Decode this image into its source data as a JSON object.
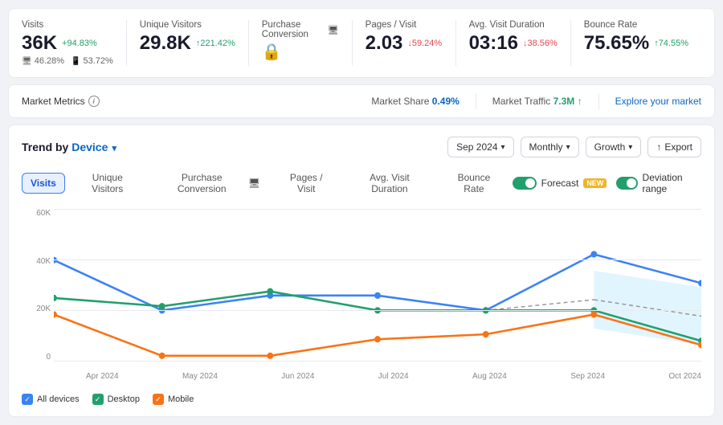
{
  "metrics": [
    {
      "id": "visits",
      "label": "Visits",
      "value": "36K",
      "change": "+94.83%",
      "change_dir": "up",
      "sub": [
        "46.28%",
        "53.72%"
      ],
      "sub_icons": [
        "monitor",
        "mobile"
      ],
      "icon": null
    },
    {
      "id": "unique-visitors",
      "label": "Unique Visitors",
      "value": "29.8K",
      "change": "↑221.42%",
      "change_dir": "up",
      "sub": [],
      "icon": null
    },
    {
      "id": "purchase-conversion",
      "label": "Purchase Conversion",
      "value": "",
      "change": "",
      "change_dir": "",
      "sub": [],
      "icon": "lock",
      "has_monitor": true
    },
    {
      "id": "pages-visit",
      "label": "Pages / Visit",
      "value": "2.03",
      "change": "↓59.24%",
      "change_dir": "down",
      "sub": [],
      "icon": null
    },
    {
      "id": "avg-visit-duration",
      "label": "Avg. Visit Duration",
      "value": "03:16",
      "change": "↓38.56%",
      "change_dir": "down",
      "sub": [],
      "icon": null
    },
    {
      "id": "bounce-rate",
      "label": "Bounce Rate",
      "value": "75.65%",
      "change": "↑74.55%",
      "change_dir": "up",
      "sub": [],
      "icon": null
    }
  ],
  "market": {
    "label": "Market Metrics",
    "share_label": "Market Share",
    "share_value": "0.49%",
    "traffic_label": "Market Traffic",
    "traffic_value": "7.3M ↑",
    "explore_label": "Explore your market"
  },
  "chart": {
    "title_prefix": "Trend by ",
    "title_link": "Device",
    "controls": {
      "date": "Sep 2024",
      "interval": "Monthly",
      "metric": "Growth",
      "export": "Export"
    },
    "tabs": [
      "Visits",
      "Unique Visitors",
      "Purchase Conversion",
      "Pages / Visit",
      "Avg. Visit Duration",
      "Bounce Rate"
    ],
    "active_tab": "Visits",
    "has_monitor_tabs": [
      2
    ],
    "forecast_label": "Forecast",
    "forecast_badge": "new",
    "deviation_label": "Deviation range",
    "y_labels": [
      "60K",
      "40K",
      "20K",
      "0"
    ],
    "x_labels": [
      "Apr 2024",
      "May 2024",
      "Jun 2024",
      "Jul 2024",
      "Aug 2024",
      "Sep 2024",
      "Oct 2024"
    ],
    "legend": [
      {
        "id": "all-devices",
        "label": "All devices",
        "color": "#3b82f6",
        "checked": true
      },
      {
        "id": "desktop",
        "label": "Desktop",
        "color": "#22a06b",
        "checked": true
      },
      {
        "id": "mobile",
        "label": "Mobile",
        "color": "#f97316",
        "checked": true
      }
    ]
  }
}
